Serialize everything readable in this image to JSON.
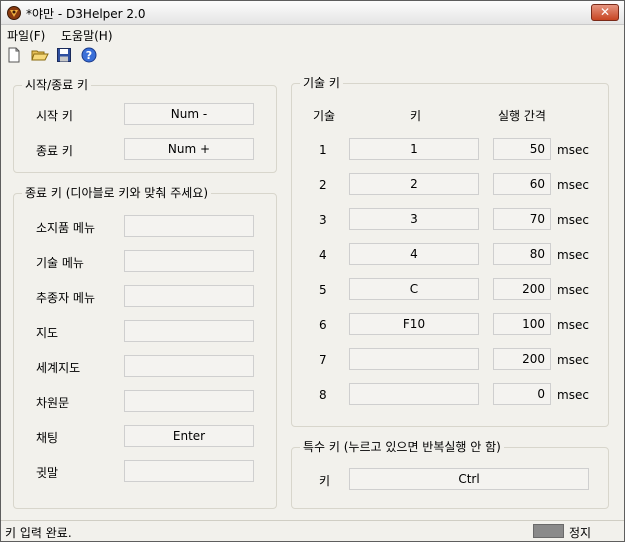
{
  "window": {
    "title": "*야만 - D3Helper 2.0",
    "close_symbol": "✕"
  },
  "menu": {
    "items": [
      "파일(F)",
      "도움말(H)"
    ]
  },
  "toolbar": {
    "icons": [
      "new-file-icon",
      "open-folder-icon",
      "save-icon",
      "help-icon"
    ]
  },
  "start_stop": {
    "title": "시작/종료 키",
    "start_label": "시작 키",
    "start_value": "Num -",
    "stop_label": "종료 키",
    "stop_value": "Num +"
  },
  "stop_keys": {
    "title": "종료 키 (디아블로 키와 맞춰 주세요)",
    "items": [
      {
        "label": "소지품 메뉴",
        "value": ""
      },
      {
        "label": "기술 메뉴",
        "value": ""
      },
      {
        "label": "추종자 메뉴",
        "value": ""
      },
      {
        "label": "지도",
        "value": ""
      },
      {
        "label": "세계지도",
        "value": ""
      },
      {
        "label": "차원문",
        "value": ""
      },
      {
        "label": "채팅",
        "value": "Enter"
      },
      {
        "label": "귓말",
        "value": ""
      }
    ]
  },
  "skills": {
    "title": "기술 키",
    "headers": {
      "skill": "기술",
      "key": "키",
      "interval": "실행 간격"
    },
    "unit": "msec",
    "rows": [
      {
        "num": "1",
        "key": "1",
        "interval": "50"
      },
      {
        "num": "2",
        "key": "2",
        "interval": "60"
      },
      {
        "num": "3",
        "key": "3",
        "interval": "70"
      },
      {
        "num": "4",
        "key": "4",
        "interval": "80"
      },
      {
        "num": "5",
        "key": "C",
        "interval": "200"
      },
      {
        "num": "6",
        "key": "F10",
        "interval": "100"
      },
      {
        "num": "7",
        "key": "",
        "interval": "200"
      },
      {
        "num": "8",
        "key": "",
        "interval": "0"
      }
    ]
  },
  "special": {
    "title": "특수 키 (누르고 있으면 반복실행 안 함)",
    "label": "키",
    "value": "Ctrl"
  },
  "status": {
    "message": "키 입력 완료.",
    "state": "정지"
  }
}
